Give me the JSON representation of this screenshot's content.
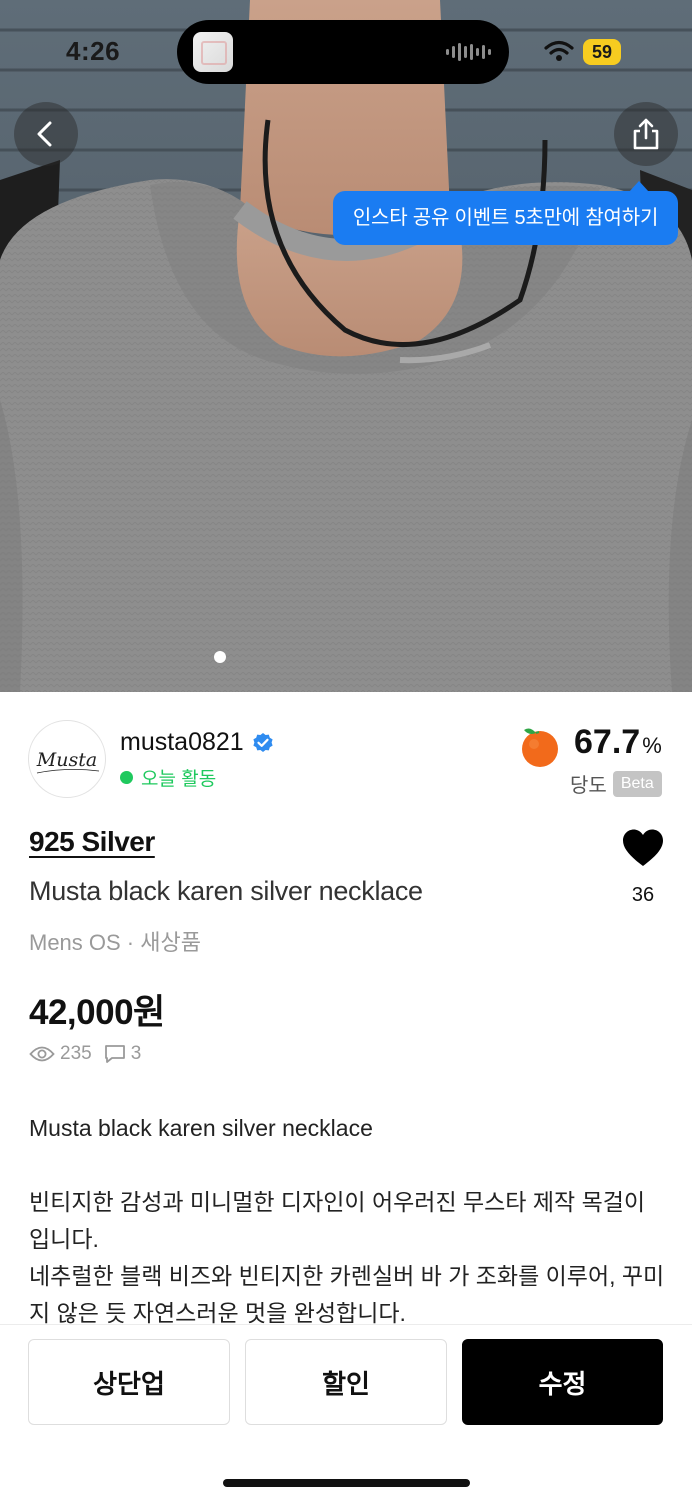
{
  "status_bar": {
    "time": "4:26",
    "battery": "59"
  },
  "tooltip": {
    "text": "인스타 공유 이벤트 5초만에 참여하기"
  },
  "seller": {
    "username": "musta0821",
    "activity": "오늘 활동",
    "avatar_text": "Musta"
  },
  "sweetness": {
    "value": "67.7",
    "unit": "%",
    "label": "당도",
    "badge": "Beta"
  },
  "product": {
    "brand": "925 Silver",
    "title": "Musta black karen silver necklace",
    "meta": "Mens OS · 새상품",
    "price": "42,000원",
    "views": "235",
    "comments": "3",
    "likes": "36"
  },
  "description": {
    "line1": "Musta black karen silver necklace",
    "line2": "빈티지한 감성과 미니멀한 디자인이 어우러진 무스타 제작 목걸이입니다.",
    "line3": "네추럴한 블랙 비즈와 빈티지한 카렌실버 바 가 조화를 이루어, 꾸미지 않은 듯 자연스러운 멋을 완성합니다."
  },
  "actions": {
    "bump": "상단업",
    "discount": "할인",
    "edit": "수정"
  },
  "colors": {
    "accent_blue": "#1a7cf2",
    "active_green": "#1fc95e",
    "battery_yellow": "#f7cc20",
    "orange": "#f26a1b"
  }
}
